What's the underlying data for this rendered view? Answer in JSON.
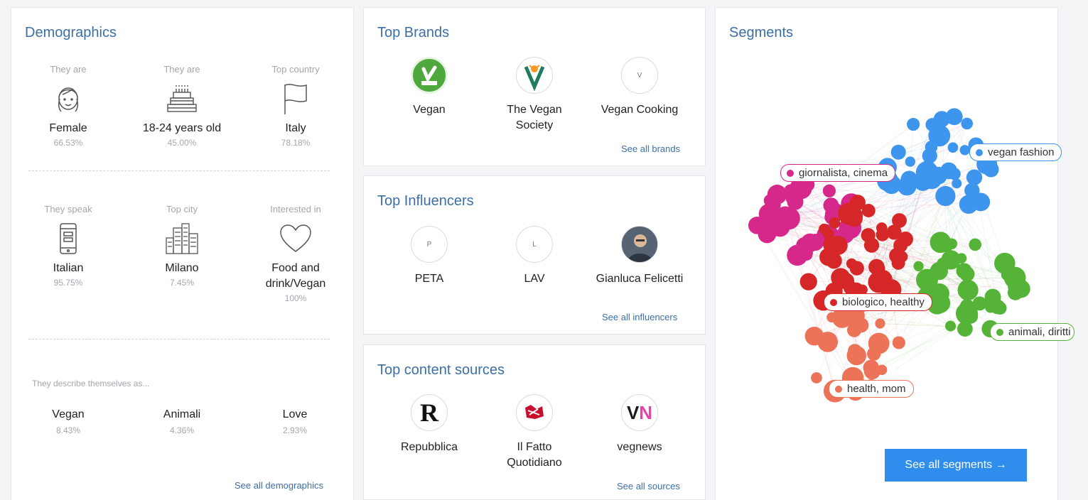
{
  "demographics": {
    "title": "Demographics",
    "row1": [
      {
        "caption": "They are",
        "value": "Female",
        "pct": "66.53%",
        "icon": "female-icon"
      },
      {
        "caption": "They are",
        "value": "18-24 years old",
        "pct": "45.00%",
        "icon": "cake-icon"
      },
      {
        "caption": "Top country",
        "value": "Italy",
        "pct": "78.18%",
        "icon": "flag-icon"
      }
    ],
    "row2": [
      {
        "caption": "They speak",
        "value": "Italian",
        "pct": "95.75%",
        "icon": "phone-icon"
      },
      {
        "caption": "Top city",
        "value": "Milano",
        "pct": "7.45%",
        "icon": "city-icon"
      },
      {
        "caption": "Interested in",
        "value": "Food and drink/Vegan",
        "pct": "100%",
        "icon": "heart-icon"
      }
    ],
    "describe_caption": "They describe themselves as...",
    "describe": [
      {
        "value": "Vegan",
        "pct": "8.43%"
      },
      {
        "value": "Animali",
        "pct": "4.36%"
      },
      {
        "value": "Love",
        "pct": "2.93%"
      }
    ],
    "see_all": "See all demographics"
  },
  "brands": {
    "title": "Top Brands",
    "items": [
      {
        "name": "Vegan",
        "logo": "",
        "icon": "vegan-logo-icon"
      },
      {
        "name": "The Vegan Society",
        "logo": "",
        "icon": "vegan-society-logo-icon"
      },
      {
        "name": "Vegan Cooking",
        "logo": "V",
        "icon": "initial-avatar"
      }
    ],
    "see_all": "See all brands"
  },
  "influencers": {
    "title": "Top Influencers",
    "items": [
      {
        "name": "PETA",
        "logo": "P",
        "icon": "initial-avatar"
      },
      {
        "name": "LAV",
        "logo": "L",
        "icon": "initial-avatar"
      },
      {
        "name": "Gianluca Felicetti",
        "logo": "",
        "icon": "person-photo-icon"
      }
    ],
    "see_all": "See all influencers"
  },
  "sources": {
    "title": "Top content sources",
    "items": [
      {
        "name": "Repubblica",
        "logo": "R",
        "icon": "repubblica-logo-icon"
      },
      {
        "name": "Il Fatto Quotidiano",
        "logo": "",
        "icon": "fatto-logo-icon"
      },
      {
        "name": "vegnews",
        "logo": "VN",
        "icon": "vegnews-logo-icon"
      }
    ],
    "see_all": "See all sources"
  },
  "segments": {
    "title": "Segments",
    "labels": [
      {
        "text": "giornalista, cinema",
        "color": "#d6288a"
      },
      {
        "text": "vegan fashion",
        "color": "#3d95ee"
      },
      {
        "text": "biologico, healthy",
        "color": "#d62728"
      },
      {
        "text": "animali, diritti",
        "color": "#55b437"
      },
      {
        "text": "health, mom",
        "color": "#ec7358"
      }
    ],
    "cta": "See all segments →"
  }
}
